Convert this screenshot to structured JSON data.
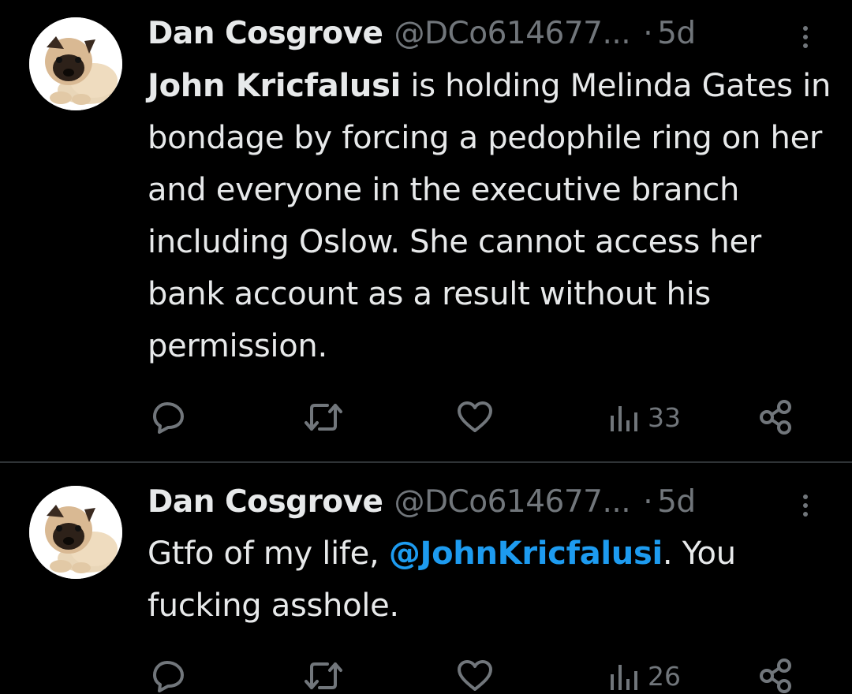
{
  "tweets": [
    {
      "name": "Dan Cosgrove",
      "handle": "@DCo614677...",
      "dot": "·",
      "time": "5d",
      "mention_bold": "John Kricfalusi",
      "text_after_mention": " is holding Melinda Gates in bondage by forcing a pedophile ring on her and everyone in the executive branch including Oslow. She cannot access her bank account as a result without his permission.",
      "views": "33",
      "icons": [
        "more-dots-icon",
        "reply-icon",
        "retweet-icon",
        "like-icon",
        "views-icon",
        "share-icon"
      ]
    },
    {
      "name": "Dan Cosgrove",
      "handle": "@DCo614677...",
      "dot": "·",
      "time": "5d",
      "text_before": "Gtfo of my life, ",
      "mention_link": "@JohnKricfalusi",
      "text_after": ". You fucking asshole.",
      "views": "26",
      "icons": [
        "more-dots-icon",
        "reply-icon",
        "retweet-icon",
        "like-icon",
        "views-icon",
        "share-icon"
      ]
    }
  ],
  "colors": {
    "background": "#000000",
    "text": "#e7e9ea",
    "secondary": "#71767b",
    "link": "#1d9bf0",
    "divider": "#2f3336"
  }
}
